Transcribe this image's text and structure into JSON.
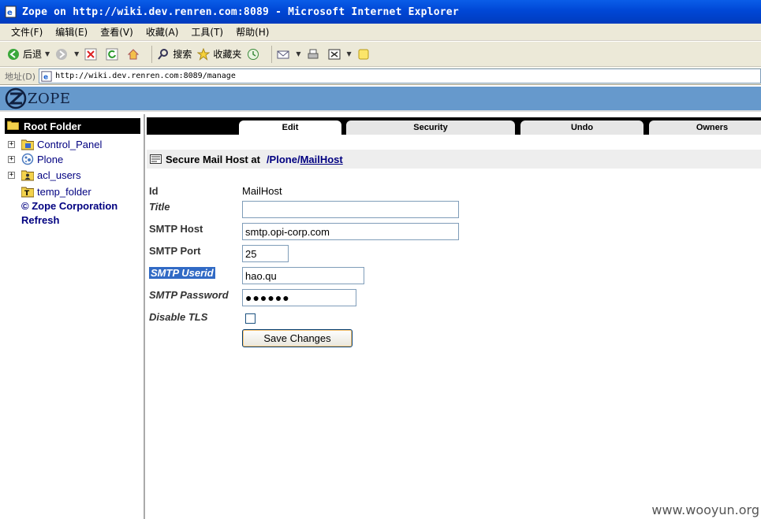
{
  "window": {
    "title": "Zope on http://wiki.dev.renren.com:8089 - Microsoft Internet Explorer"
  },
  "menu": [
    "文件(F)",
    "编辑(E)",
    "查看(V)",
    "收藏(A)",
    "工具(T)",
    "帮助(H)"
  ],
  "toolbar": {
    "back": "后退",
    "search": "搜索",
    "favorites": "收藏夹"
  },
  "address": {
    "label": "地址(D)",
    "url": "http://wiki.dev.renren.com:8089/manage"
  },
  "banner": {
    "logo_text": "ZOPE"
  },
  "tree": {
    "root": "Root Folder",
    "items": [
      {
        "label": "Control_Panel",
        "icon": "control-panel-icon",
        "expandable": true
      },
      {
        "label": "Plone",
        "icon": "plone-icon",
        "expandable": true
      },
      {
        "label": "acl_users",
        "icon": "user-folder-icon",
        "expandable": true
      },
      {
        "label": "temp_folder",
        "icon": "temp-folder-icon",
        "expandable": false
      }
    ],
    "copyright": "© Zope Corporation",
    "refresh": "Refresh"
  },
  "tabs": [
    {
      "label": "Edit",
      "active": true
    },
    {
      "label": "Security",
      "active": false
    },
    {
      "label": "Undo",
      "active": false
    },
    {
      "label": "Owners",
      "active": false
    }
  ],
  "heading": {
    "prefix": "Secure Mail Host at",
    "path_root": "/Plone/",
    "path_link": "MailHost"
  },
  "form": {
    "id_label": "Id",
    "id_value": "MailHost",
    "title_label": "Title",
    "title_value": "",
    "smtp_host_label": "SMTP Host",
    "smtp_host_value": "smtp.opi-corp.com",
    "smtp_port_label": "SMTP Port",
    "smtp_port_value": "25",
    "smtp_userid_label": "SMTP Userid",
    "smtp_userid_value": "hao.qu",
    "smtp_password_label": "SMTP Password",
    "smtp_password_value": "●●●●●●",
    "disable_tls_label": "Disable TLS",
    "disable_tls_checked": false,
    "save_label": "Save Changes"
  },
  "watermark": "www.wooyun.org"
}
